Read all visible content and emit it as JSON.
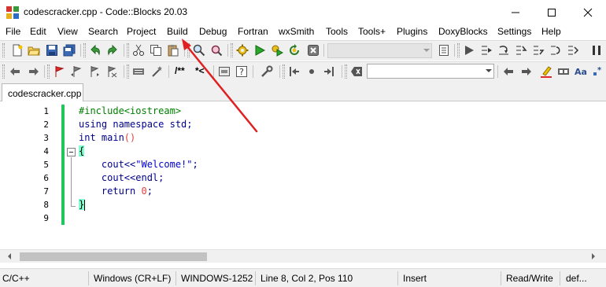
{
  "window": {
    "title": "codescracker.cpp - Code::Blocks 20.03",
    "controls": [
      "minimize",
      "maximize",
      "close"
    ]
  },
  "menu": {
    "items": [
      "File",
      "Edit",
      "View",
      "Search",
      "Project",
      "Build",
      "Debug",
      "Fortran",
      "wxSmith",
      "Tools",
      "Tools+",
      "Plugins",
      "DoxyBlocks",
      "Settings",
      "Help"
    ]
  },
  "toolbar1": {
    "icons": [
      "new-file-icon",
      "open-file-icon",
      "save-icon",
      "save-all-icon",
      "undo-icon",
      "redo-icon",
      "cut-icon",
      "copy-icon",
      "paste-icon",
      "find-icon",
      "replace-icon",
      "build-icon",
      "run-icon",
      "build-and-run-icon",
      "rebuild-icon",
      "abort-icon",
      "build-target-dropdown",
      "jump-icon",
      "debug-run-icon",
      "step-icon",
      "step-into-icon",
      "step-out-icon",
      "pause-icon"
    ],
    "build_target": ""
  },
  "toolbar2": {
    "comment_label": "/**",
    "uncomment_label": "*<",
    "search_value": ""
  },
  "tabs": [
    {
      "label": "codescracker.cpp",
      "active": true
    }
  ],
  "editor": {
    "line_numbers": [
      "1",
      "2",
      "3",
      "4",
      "5",
      "6",
      "7",
      "8",
      "9"
    ],
    "lines": [
      {
        "parts": [
          {
            "t": "#include<iostream>",
            "c": "pp"
          }
        ]
      },
      {
        "parts": [
          {
            "t": "using namespace std;",
            "c": "kw"
          }
        ]
      },
      {
        "parts": [
          {
            "t": "int main",
            "c": "kw"
          },
          {
            "t": "()",
            "c": "num"
          }
        ]
      },
      {
        "parts": [
          {
            "t": "{",
            "c": "brace-hl"
          }
        ]
      },
      {
        "parts": [
          {
            "t": "    cout<<",
            "c": "kw"
          },
          {
            "t": "\"Welcome!\"",
            "c": "str"
          },
          {
            "t": ";",
            "c": "kw"
          }
        ]
      },
      {
        "parts": [
          {
            "t": "    cout<<endl;",
            "c": "kw"
          }
        ]
      },
      {
        "parts": [
          {
            "t": "    return ",
            "c": "kw"
          },
          {
            "t": "0",
            "c": "num"
          },
          {
            "t": ";",
            "c": "kw"
          }
        ]
      },
      {
        "parts": [
          {
            "t": "}",
            "c": "brace-hl"
          }
        ]
      },
      {
        "parts": []
      }
    ]
  },
  "statusbar": {
    "language": "C/C++",
    "line_endings": "Windows (CR+LF)",
    "encoding": "WINDOWS-1252",
    "position": "Line 8, Col 2, Pos 110",
    "mode": "Insert",
    "access": "Read/Write",
    "extra": "def..."
  },
  "colors": {
    "change_bar": "#22c55e",
    "annotation_arrow": "#e02020",
    "keyword": "#00008b",
    "preprocessor": "#008000",
    "string": "#0000cd",
    "number": "#e04040"
  }
}
